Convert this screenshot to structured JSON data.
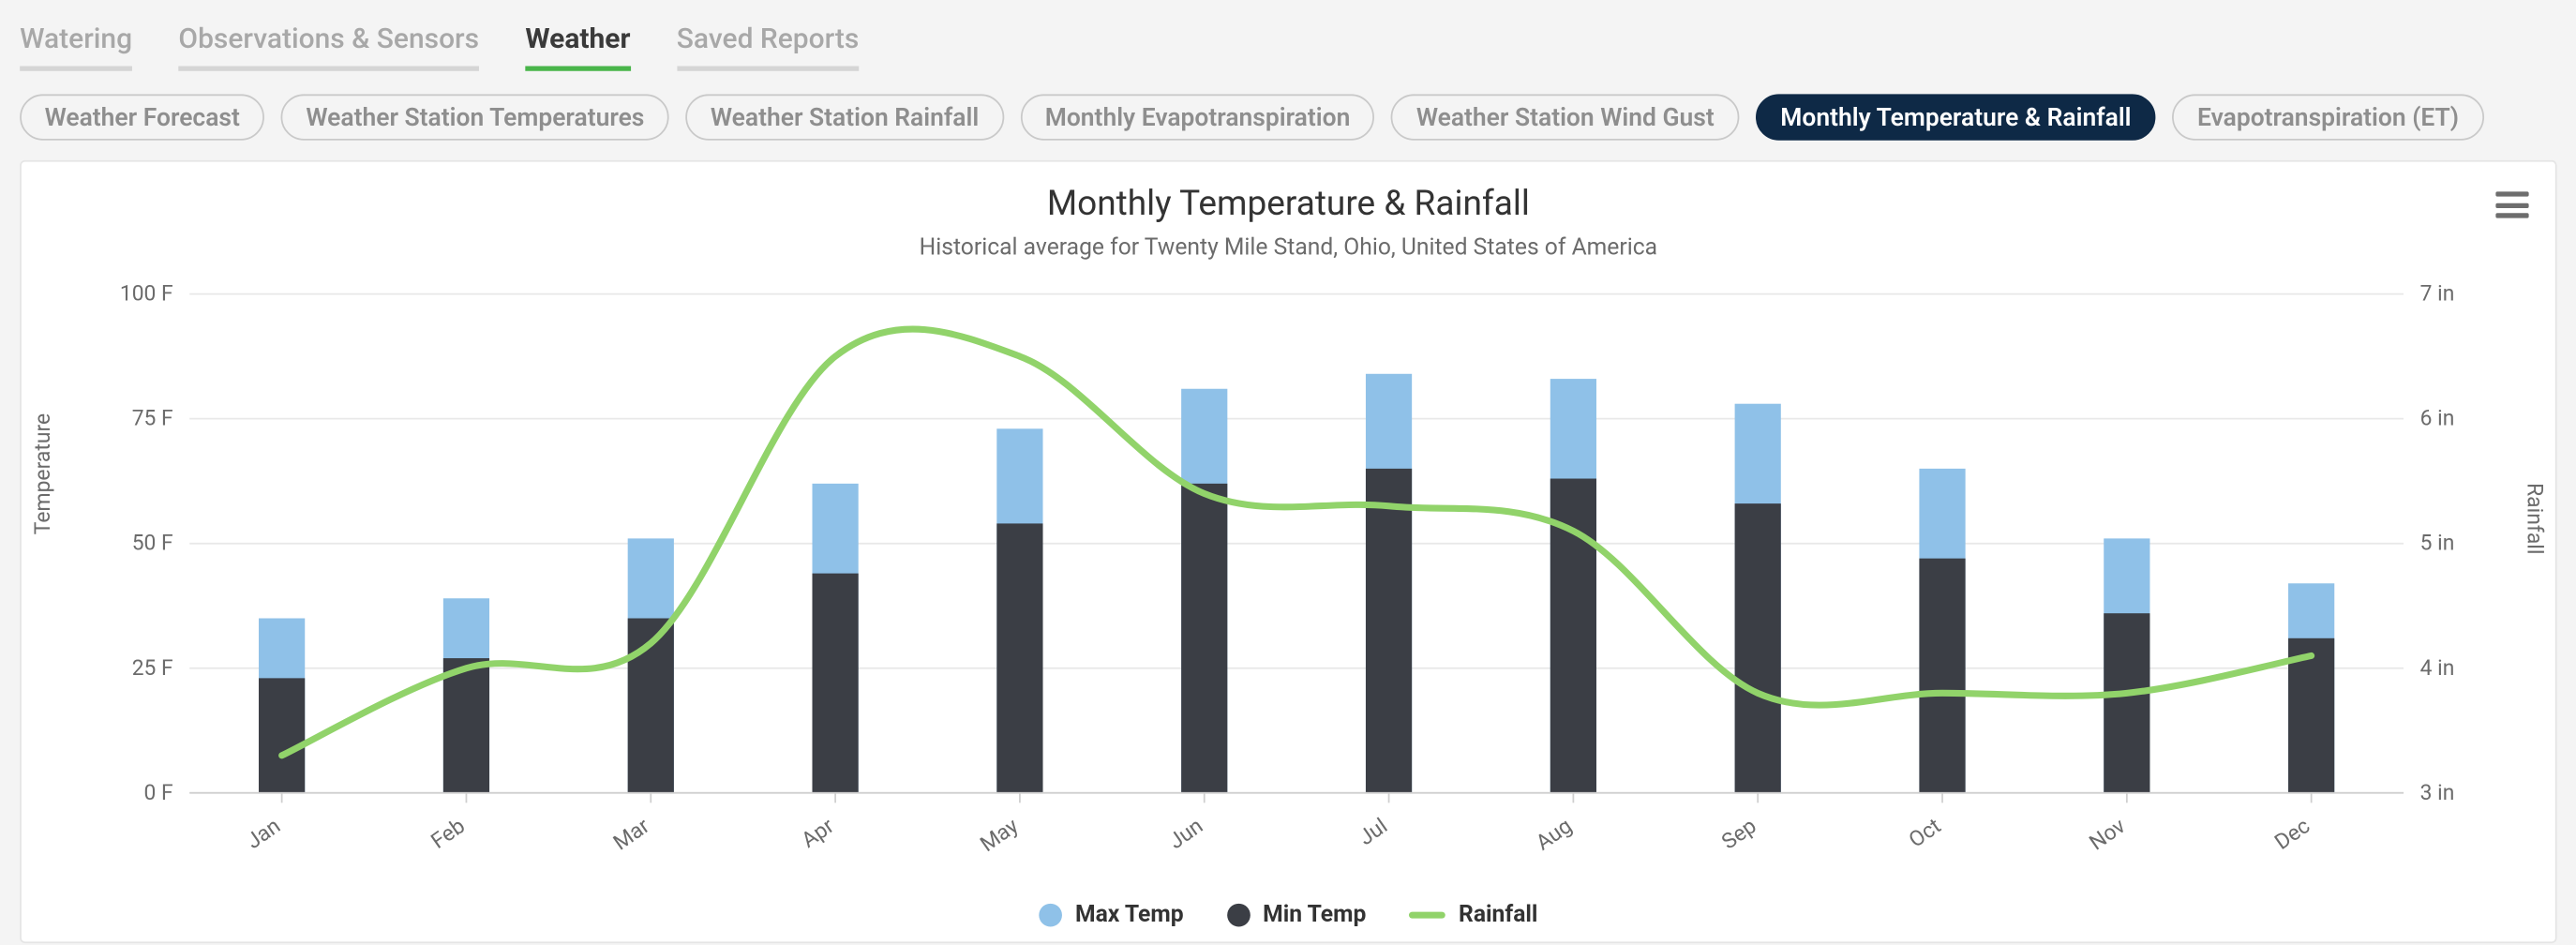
{
  "tabs": {
    "items": [
      {
        "label": "Watering",
        "active": false
      },
      {
        "label": "Observations & Sensors",
        "active": false
      },
      {
        "label": "Weather",
        "active": true
      },
      {
        "label": "Saved Reports",
        "active": false
      }
    ]
  },
  "pills": {
    "items": [
      {
        "label": "Weather Forecast",
        "active": false
      },
      {
        "label": "Weather Station Temperatures",
        "active": false
      },
      {
        "label": "Weather Station Rainfall",
        "active": false
      },
      {
        "label": "Monthly Evapotranspiration",
        "active": false
      },
      {
        "label": "Weather Station Wind Gust",
        "active": false
      },
      {
        "label": "Monthly Temperature & Rainfall",
        "active": true
      },
      {
        "label": "Evapotranspiration (ET)",
        "active": false
      }
    ]
  },
  "chart": {
    "title": "Monthly Temperature & Rainfall",
    "subtitle": "Historical average for Twenty Mile Stand, Ohio, United States of America",
    "y_left_label": "Temperature",
    "y_right_label": "Rainfall",
    "y_left_ticks": [
      "0 F",
      "25 F",
      "50 F",
      "75 F",
      "100 F"
    ],
    "y_right_ticks": [
      "3 in",
      "4 in",
      "5 in",
      "6 in",
      "7 in"
    ],
    "legend": {
      "max": "Max Temp",
      "min": "Min Temp",
      "rain": "Rainfall"
    },
    "colors": {
      "max": "#8fc1e8",
      "min": "#3b3e45",
      "rain": "#91d36a",
      "grid": "#e8e8e8",
      "tick": "#6b6b6b"
    }
  },
  "chart_data": {
    "type": "bar+line",
    "categories": [
      "Jan",
      "Feb",
      "Mar",
      "Apr",
      "May",
      "Jun",
      "Jul",
      "Aug",
      "Sep",
      "Oct",
      "Nov",
      "Dec"
    ],
    "series": [
      {
        "name": "Max Temp",
        "kind": "bar",
        "axis": "left",
        "values": [
          35,
          39,
          51,
          62,
          73,
          81,
          84,
          83,
          78,
          65,
          51,
          42
        ]
      },
      {
        "name": "Min Temp",
        "kind": "bar",
        "axis": "left",
        "values": [
          23,
          27,
          35,
          44,
          54,
          62,
          65,
          63,
          58,
          47,
          36,
          31
        ]
      },
      {
        "name": "Rainfall",
        "kind": "line",
        "axis": "right",
        "values": [
          3.3,
          4.0,
          4.2,
          6.5,
          6.5,
          5.4,
          5.3,
          5.1,
          3.8,
          3.8,
          3.8,
          4.1
        ]
      }
    ],
    "title": "Monthly Temperature & Rainfall",
    "subtitle": "Historical average for Twenty Mile Stand, Ohio, United States of America",
    "xlabel": "",
    "ylabel_left": "Temperature",
    "ylabel_right": "Rainfall",
    "ylim_left": [
      0,
      100
    ],
    "ylim_right": [
      3,
      7
    ],
    "y_left_unit": "F",
    "y_right_unit": "in"
  }
}
